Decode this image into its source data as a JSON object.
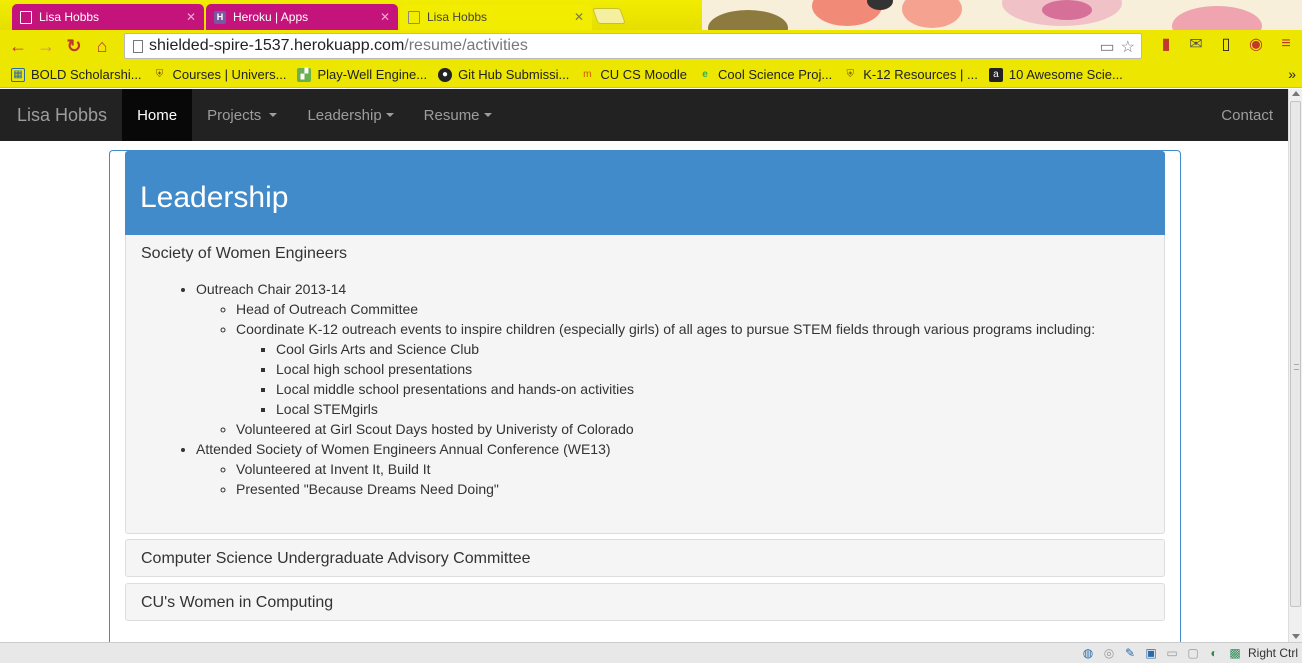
{
  "browser": {
    "tabs": [
      {
        "title": "Lisa Hobbs",
        "icon": "page-icon",
        "active": false
      },
      {
        "title": "Heroku | Apps",
        "icon": "heroku-icon",
        "active": false
      },
      {
        "title": "Lisa Hobbs",
        "icon": "page-icon",
        "active": true
      }
    ],
    "url": {
      "host": "shielded-spire-1537.herokuapp.com",
      "path": "/resume/activities"
    },
    "bookmarks": [
      "BOLD Scholarshi...",
      "Courses | Univers...",
      "Play-Well Engine...",
      "Git Hub Submissi...",
      "CU CS Moodle",
      "Cool Science Proj...",
      "K-12 Resources | ...",
      "10 Awesome Scie..."
    ],
    "bookmarks_more": "»",
    "colors": {
      "tab_inactive": "#c4137a",
      "chrome": "#ede600"
    }
  },
  "site_nav": {
    "brand": "Lisa Hobbs",
    "items": [
      {
        "label": "Home",
        "active": true
      },
      {
        "label": "Projects",
        "dropdown": true
      },
      {
        "label": "Leadership",
        "dropdown": true
      },
      {
        "label": "Resume",
        "dropdown": true
      }
    ],
    "contact": "Contact"
  },
  "page": {
    "title": "Leadership",
    "sections": [
      {
        "heading": "Society of Women Engineers",
        "expanded": true,
        "items": [
          {
            "text": "Outreach Chair 2013-14",
            "children": [
              {
                "text": "Head of Outreach Committee"
              },
              {
                "text": "Coordinate K-12 outreach events to inspire children (especially girls) of all ages to pursue STEM fields through various programs including:",
                "children": [
                  "Cool Girls Arts and Science Club",
                  "Local high school presentations",
                  "Local middle school presentations and hands-on activities",
                  "Local STEMgirls"
                ]
              },
              {
                "text": "Volunteered at Girl Scout Days hosted by Univeristy of Colorado"
              }
            ]
          },
          {
            "text": "Attended Society of Women Engineers Annual Conference (WE13)",
            "children": [
              {
                "text": "Volunteered at Invent It, Build It"
              },
              {
                "text": "Presented \"Because Dreams Need Doing\""
              }
            ]
          }
        ]
      },
      {
        "heading": "Computer Science Undergraduate Advisory Committee",
        "expanded": false
      },
      {
        "heading": "CU's Women in Computing",
        "expanded": false
      }
    ],
    "accent_color": "#428bca"
  },
  "system_tray": {
    "label": "Right Ctrl"
  }
}
